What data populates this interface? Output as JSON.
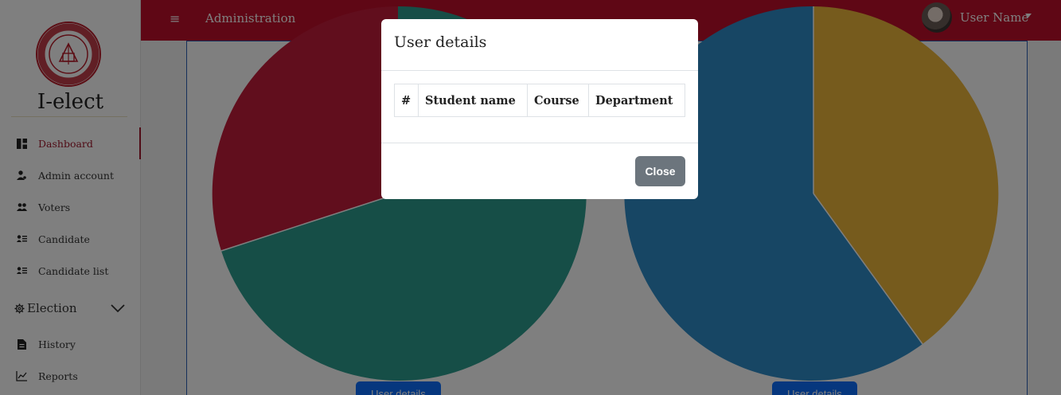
{
  "app": {
    "brand": "I-elect",
    "topbar_title": "Administration",
    "user_name": "User Name",
    "menu_icon": "≡"
  },
  "sidebar": {
    "items": [
      {
        "label": "Dashboard",
        "icon": "dashboard-icon",
        "active": true
      },
      {
        "label": "Admin account",
        "icon": "user-cog-icon",
        "active": false
      },
      {
        "label": "Voters",
        "icon": "users-icon",
        "active": false
      },
      {
        "label": "Candidate",
        "icon": "user-list-icon",
        "active": false
      },
      {
        "label": "Candidate list",
        "icon": "user-list-icon",
        "active": false
      }
    ],
    "group": {
      "label": "Election",
      "icon": "gear-icon",
      "expanded": false
    },
    "bottom_items": [
      {
        "label": "History",
        "icon": "file-icon"
      },
      {
        "label": "Reports",
        "icon": "line-chart-icon"
      }
    ]
  },
  "charts": [
    {
      "type": "pie",
      "colors": [
        "#c21d3b",
        "#2c9c8e"
      ],
      "button_label": "User details"
    },
    {
      "type": "pie",
      "colors": [
        "#2e8cc9",
        "#ecb63a"
      ],
      "button_label": "User details"
    }
  ],
  "modal": {
    "title": "User details",
    "table_headers": [
      "#",
      "Student name",
      "Course",
      "Department"
    ],
    "rows": [],
    "close_label": "Close"
  },
  "colors": {
    "topbar": "#bf0f2a",
    "active": "#a0182c",
    "primary": "#0d6efd",
    "secondary": "#6c757d"
  }
}
